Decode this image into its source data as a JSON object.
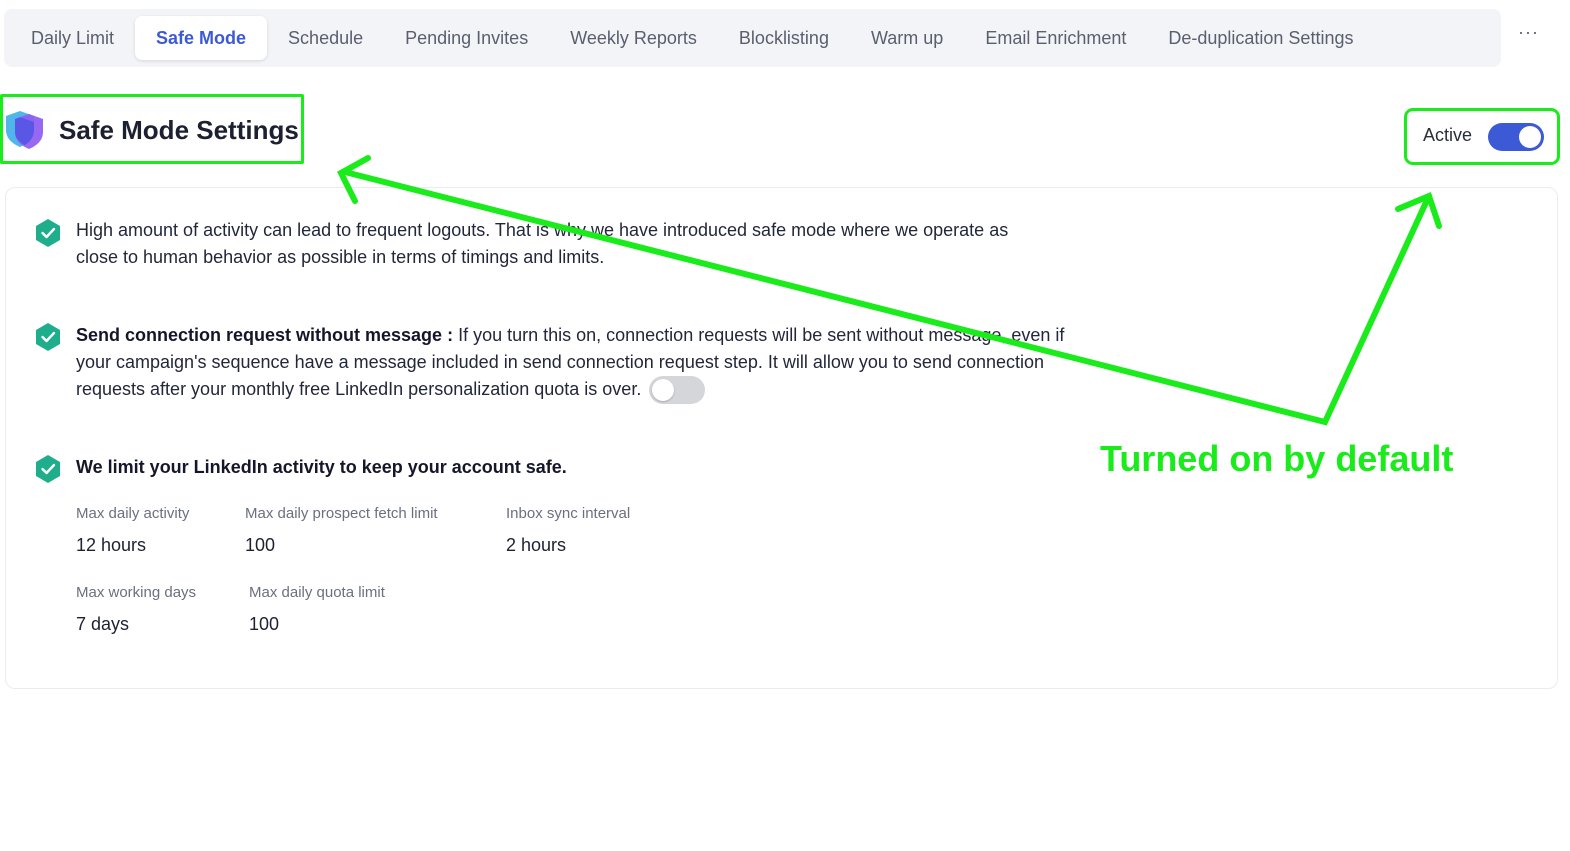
{
  "tabs": [
    {
      "label": "Daily Limit",
      "active": false
    },
    {
      "label": "Safe Mode",
      "active": true
    },
    {
      "label": "Schedule",
      "active": false
    },
    {
      "label": "Pending Invites",
      "active": false
    },
    {
      "label": "Weekly Reports",
      "active": false
    },
    {
      "label": "Blocklisting",
      "active": false
    },
    {
      "label": "Warm up",
      "active": false
    },
    {
      "label": "Email Enrichment",
      "active": false
    },
    {
      "label": "De-duplication Settings",
      "active": false
    }
  ],
  "more_label": "···",
  "header": {
    "title": "Safe Mode Settings",
    "status_label": "Active",
    "status_on": true
  },
  "items": {
    "intro": "High amount of activity can lead to frequent logouts. That is why we have introduced safe mode where we operate as close to human behavior as possible in terms of timings and limits.",
    "connection_title": "Send connection request without message :",
    "connection_body": " If you turn this on, connection requests will be sent without message, even if your campaign's sequence have a message included in send connection request step. It will allow you to send connection requests after your monthly free LinkedIn personalization quota is over.",
    "connection_toggle_on": false,
    "limit_title": "We limit your LinkedIn activity to keep your account safe."
  },
  "stats": {
    "max_daily_activity": {
      "label": "Max daily activity",
      "value": "12 hours"
    },
    "max_prospect_fetch": {
      "label": "Max daily prospect fetch limit",
      "value": "100"
    },
    "inbox_sync": {
      "label": "Inbox sync interval",
      "value": "2 hours"
    },
    "max_working_days": {
      "label": "Max working days",
      "value": "7 days"
    },
    "max_daily_quota": {
      "label": "Max daily quota limit",
      "value": "100"
    }
  },
  "annotation": {
    "text": "Turned on by default",
    "color": "#1aeb1a"
  },
  "colors": {
    "accent": "#3d5ad6",
    "check": "#1fae8c"
  }
}
